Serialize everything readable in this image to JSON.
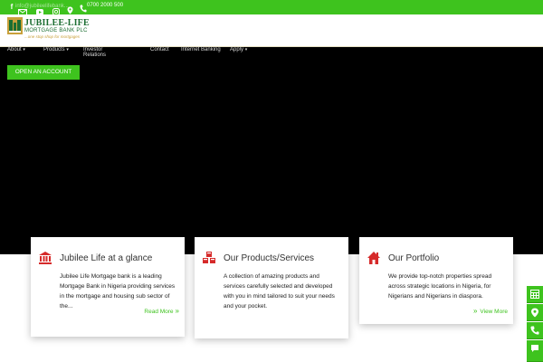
{
  "topbar": {
    "icons": [
      "facebook-icon",
      "mail-icon",
      "youtube-icon",
      "instagram-icon",
      "location-icon"
    ],
    "email_text": "info@jubileelifebank...",
    "phone": "0700 2000 500"
  },
  "brand": {
    "name": "JUBILEE-LIFE",
    "sub": "MORTGAGE BANK PLC",
    "tagline": "...one stop shop for mortgages"
  },
  "nav": {
    "items": [
      "About",
      "Products",
      "Investor Relations",
      "Contact",
      "Internet Banking",
      "Apply"
    ]
  },
  "hero": {
    "cta_label": "OPEN AN ACCOUNT"
  },
  "cards": [
    {
      "title": "Jubilee Life at a glance",
      "body": "Jubilee Life Mortgage bank is a leading Mortgage Bank in Nigeria providing services in the mortgage and housing sub sector of the...",
      "link": "Read More",
      "icon": "bank-icon"
    },
    {
      "title": "Our Products/Services",
      "body": "A collection of amazing products and services carefully selected and developed with you in mind tailored to suit your needs and your pocket.",
      "link": "",
      "icon": "cubes-icon"
    },
    {
      "title": "Our Portfolio",
      "body": "We provide top-notch properties spread across strategic locations in Nigeria, for Nigerians and Nigerians in diaspora.",
      "link": "View More",
      "icon": "home-icon"
    }
  ],
  "side_buttons": [
    "calculator-icon",
    "map-pin-icon",
    "phone-icon",
    "chat-icon"
  ],
  "colors": {
    "accent": "#3ec31e",
    "brand_green": "#1c6e32",
    "brand_gold": "#c9a03b",
    "hero": "#000000",
    "icon_red": "#d62a2a"
  }
}
